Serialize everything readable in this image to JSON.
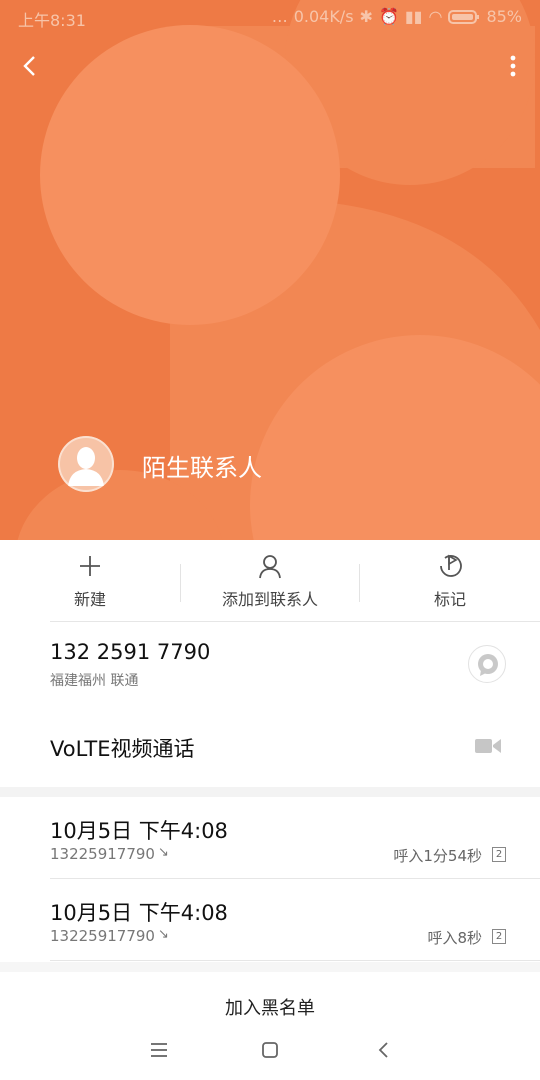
{
  "status_bar": {
    "time": "上午8:31",
    "net_speed": "0.04K/s",
    "battery": "85%"
  },
  "colors": {
    "header_bg": "#ee7a45",
    "header_shape_light": "#f6905f",
    "header_shape_mid": "#f28753"
  },
  "header": {
    "contact_name": "陌生联系人",
    "icons": {
      "back": "back-arrow-icon",
      "more": "more-vertical-icon",
      "avatar": "default-avatar-icon"
    }
  },
  "actions": [
    {
      "label": "新建",
      "icon": "plus-icon"
    },
    {
      "label": "添加到联系人",
      "icon": "person-icon"
    },
    {
      "label": "标记",
      "icon": "flag-icon"
    }
  ],
  "phone": {
    "number": "132 2591 7790",
    "location": "福建福州 联通",
    "sms_icon": "message-bubble-icon"
  },
  "volte": {
    "label": "VoLTE视频通话",
    "icon": "video-camera-icon"
  },
  "call_logs": [
    {
      "date": "10月5日 下午4:08",
      "number": "13225917790",
      "arrow": "↘",
      "detail": "呼入1分54秒",
      "sim": "2"
    },
    {
      "date": "10月5日 下午4:08",
      "number": "13225917790",
      "arrow": "↘",
      "detail": "呼入8秒",
      "sim": "2"
    }
  ],
  "footer": {
    "blacklist_label": "加入黑名单"
  },
  "navbar": {
    "icons": [
      "menu-icon",
      "home-icon",
      "back-icon"
    ]
  }
}
